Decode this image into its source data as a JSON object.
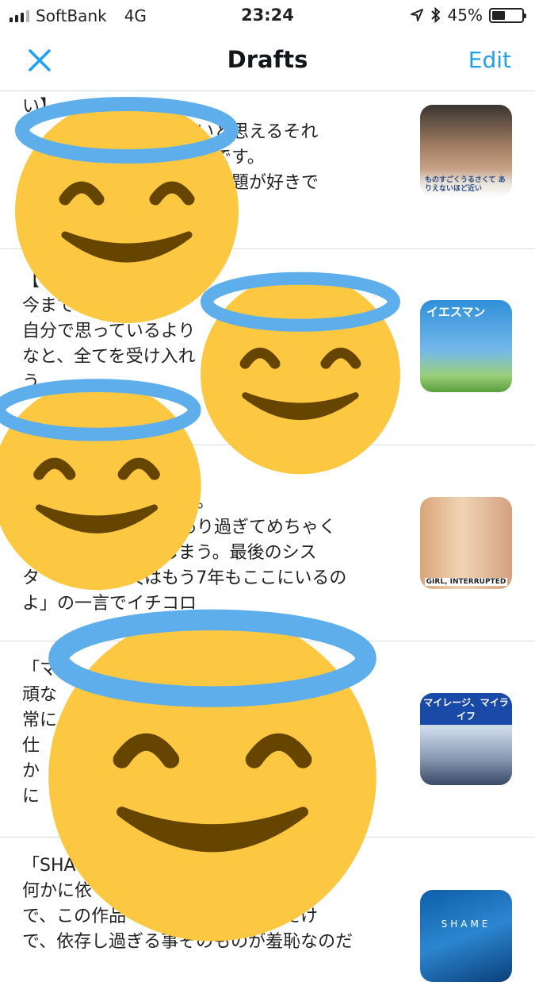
{
  "status": {
    "carrier": "SoftBank",
    "network": "4G",
    "time": "23:24",
    "battery": "45%",
    "battery_level": 0.45
  },
  "nav": {
    "title": "Drafts",
    "edit_label": "Edit",
    "close_icon": "close-icon"
  },
  "drafts": [
    {
      "text": "い】\n　　　　　　　　愛しいと思えるそれ\n　　　　　　　　に脱帽です。\n　　　　　　　　作品は和題が好きで",
      "thumb_caption": "ものすごくうるさくて ありえないほど近い"
    },
    {
      "text": "【\n今まで　　番意\n自分で思っているより\nなと、全てを受け入れ\nう",
      "thumb_caption": "イエスマン"
    },
    {
      "text": "\n　　　　　　　　作品。\n　　　　　　　力があり過ぎてめちゃく\n　　　　　　んでしまう。最後のシス\nタ　　　　　女はもう7年もここにいるの\nよ」の一言でイチコロ",
      "thumb_caption": "GIRL, INTERRUPTED"
    },
    {
      "text": "「マ\n頑な　　　　　　　　　　　　が非\n常に\n仕　　　　　　　　　　　　　入\nか\nに　　　　　　　　　　　　　…",
      "thumb_caption": "マイレージ、マイライフ"
    },
    {
      "text": "「SHA\n何かに依　　　　　　　　ある事\nで、この作品　　　　　の内容なだけ\nで、依存し過ぎる事そのものが羞恥なのだ",
      "thumb_caption": "SHAME"
    }
  ],
  "colors": {
    "accent": "#1da1f2",
    "emoji_face": "#fcc841",
    "emoji_halo": "#5daeea",
    "emoji_features": "#664500"
  },
  "overlay_icons": [
    "smiling-face-with-halo-icon",
    "smiling-face-with-halo-icon",
    "smiling-face-with-halo-icon",
    "smiling-face-with-halo-icon"
  ]
}
